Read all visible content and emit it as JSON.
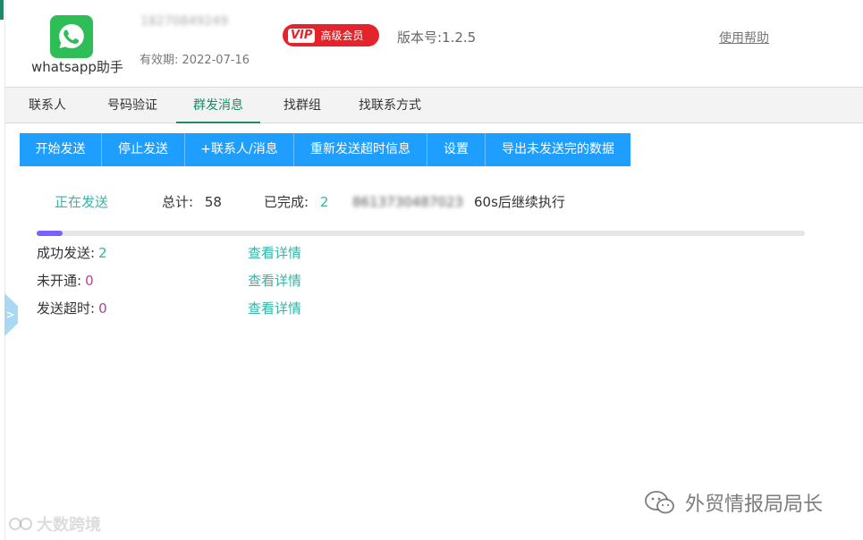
{
  "header": {
    "app_name": "whatsapp助手",
    "account_id": "18270849249",
    "validity_label": "有效期:",
    "validity_date": "2022-07-16",
    "vip_tag": "VIP",
    "vip_text": "高级会员",
    "version": "版本号:1.2.5",
    "help_link": "使用帮助"
  },
  "tabs": [
    {
      "label": "联系人"
    },
    {
      "label": "号码验证"
    },
    {
      "label": "群发消息",
      "active": true
    },
    {
      "label": "找群组"
    },
    {
      "label": "找联系方式"
    }
  ],
  "toolbar": {
    "start": "开始发送",
    "stop": "停止发送",
    "add": "+联系人/消息",
    "resend": "重新发送超时信息",
    "settings": "设置",
    "export": "导出未发送完的数据"
  },
  "status": {
    "state": "正在发送",
    "total_label": "总计:",
    "total_value": "58",
    "done_label": "已完成:",
    "done_value": "2",
    "current_number": "8613730487023",
    "countdown": "60s后继续执行"
  },
  "progress": {
    "fraction": 0.034
  },
  "stats": {
    "success_label": "成功发送:",
    "success_value": "2",
    "unopened_label": "未开通:",
    "unopened_value": "0",
    "timeout_label": "发送超时:",
    "timeout_value": "0",
    "detail_link": "查看详情"
  },
  "side_tab_glyph": ">",
  "watermarks": {
    "left": "大数跨境",
    "right": "外贸情报局局长"
  },
  "colors": {
    "accent_green": "#1e8a6a",
    "button_blue": "#1e9fff",
    "link_teal": "#39b3a6",
    "vip_red": "#e5232b",
    "progress_purple": "#7b61ff"
  }
}
